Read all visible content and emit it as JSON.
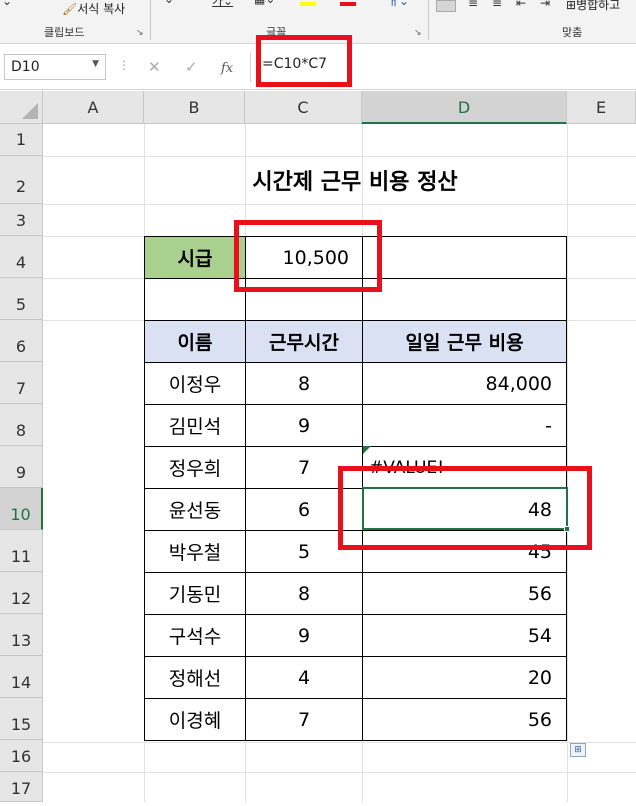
{
  "ribbon": {
    "format_painter_label": "서식 복사",
    "clipboard_group": "클립보드",
    "font_group": "글꼴",
    "align_group": "맞춤",
    "merge_label": "병합하고"
  },
  "formula_bar": {
    "name_box": "D10",
    "fx_label": "fx",
    "formula": "=C10*C7"
  },
  "columns": [
    "A",
    "B",
    "C",
    "D",
    "E"
  ],
  "rows": [
    "1",
    "2",
    "3",
    "4",
    "5",
    "6",
    "7",
    "8",
    "9",
    "10",
    "11",
    "12",
    "13",
    "14",
    "15",
    "16",
    "17"
  ],
  "sheet": {
    "title": "시간제 근무 비용 정산",
    "wage_label": "시급",
    "wage_value": "10,500",
    "headers": [
      "이름",
      "근무시간",
      "일일 근무 비용"
    ],
    "data": [
      {
        "name": "이정우",
        "hours": "8",
        "cost": "84,000"
      },
      {
        "name": "김민석",
        "hours": "9",
        "cost": "-"
      },
      {
        "name": "정우희",
        "hours": "7",
        "cost": "#VALUE!"
      },
      {
        "name": "윤선동",
        "hours": "6",
        "cost": "48"
      },
      {
        "name": "박우철",
        "hours": "5",
        "cost": "45"
      },
      {
        "name": "기동민",
        "hours": "8",
        "cost": "56"
      },
      {
        "name": "구석수",
        "hours": "9",
        "cost": "54"
      },
      {
        "name": "정해선",
        "hours": "4",
        "cost": "20"
      },
      {
        "name": "이경혜",
        "hours": "7",
        "cost": "56"
      }
    ]
  },
  "colors": {
    "accent": "#217346",
    "highlight": "#e8101a",
    "header_blue": "#d9e1f2",
    "header_green": "#a9d08e"
  }
}
